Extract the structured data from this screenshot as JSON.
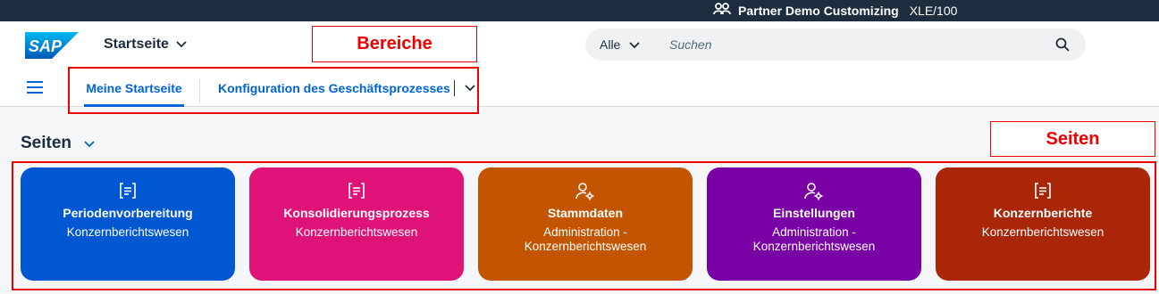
{
  "topbar": {
    "system_name": "Partner Demo Customizing",
    "system_id": "XLE/100",
    "icon": "people-icon"
  },
  "header": {
    "logo_text": "SAP",
    "home_title": "Startseite"
  },
  "search": {
    "scope": "Alle",
    "placeholder": "Suchen"
  },
  "nav": {
    "tabs": [
      {
        "label": "Meine Startseite",
        "active": true
      },
      {
        "label": "Konfiguration des Geschäftsprozesses",
        "active": false
      }
    ]
  },
  "annotations": {
    "areas_label": "Bereiche",
    "pages_label": "Seiten",
    "color": "#e00000"
  },
  "section": {
    "title": "Seiten"
  },
  "tiles": [
    {
      "title": "Periodenvorbereitung",
      "subtitle": "Konzernberichtswesen",
      "color": "#0057d2",
      "icon": "document-list-icon"
    },
    {
      "title": "Konsolidierungsprozess",
      "subtitle": "Konzernberichtswesen",
      "color": "#df1278",
      "icon": "document-list-icon"
    },
    {
      "title": "Stammdaten",
      "subtitle": "Administration - Konzernberichtswesen",
      "color": "#c35500",
      "icon": "user-settings-icon"
    },
    {
      "title": "Einstellungen",
      "subtitle": "Administration - Konzernberichtswesen",
      "color": "#7800a4",
      "icon": "user-settings-icon"
    },
    {
      "title": "Konzernberichte",
      "subtitle": "Konzernberichtswesen",
      "color": "#aa2608",
      "icon": "document-list-icon"
    }
  ]
}
